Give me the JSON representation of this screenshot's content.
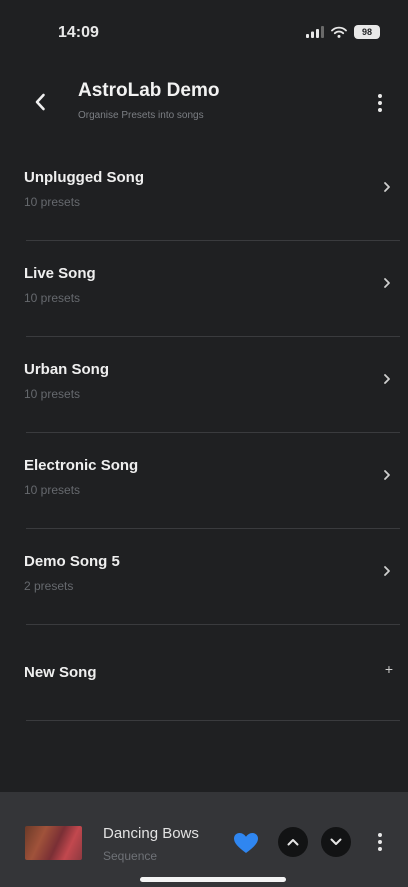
{
  "status_bar": {
    "time": "14:09",
    "battery": "98"
  },
  "header": {
    "title": "AstroLab Demo",
    "subtitle": "Organise Presets into songs"
  },
  "songs": [
    {
      "name": "Unplugged Song",
      "count": "10 presets"
    },
    {
      "name": "Live Song",
      "count": "10 presets"
    },
    {
      "name": "Urban Song",
      "count": "10 presets"
    },
    {
      "name": "Electronic Song",
      "count": "10 presets"
    },
    {
      "name": "Demo Song 5",
      "count": "2 presets"
    }
  ],
  "new_song": {
    "label": "New Song",
    "icon": "+"
  },
  "player": {
    "title": "Dancing Bows",
    "type": "Sequence",
    "heart_color": "#2f86f0"
  },
  "icons": {
    "back": "chevron-left-icon",
    "more": "more-vertical-icon",
    "row": "chevron-right-icon",
    "favorite": "heart-icon",
    "up": "chevron-up-icon",
    "down": "chevron-down-icon"
  }
}
